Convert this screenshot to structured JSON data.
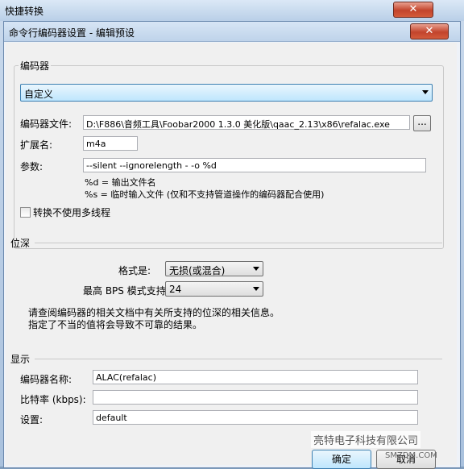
{
  "outer_window": {
    "title": "快捷转换",
    "close_label": "✕",
    "tab_fragment": "……"
  },
  "dialog": {
    "title": "命令行编码器设置 - 编辑预设",
    "close_label": "✕"
  },
  "encoder": {
    "group_label": "编码器",
    "preset_selected": "自定义",
    "file_label": "编码器文件:",
    "file_value": "D:\\F886\\音频工具\\Foobar2000 1.3.0 美化版\\qaac_2.13\\x86\\refalac.exe",
    "browse_label": "...",
    "ext_label": "扩展名:",
    "ext_value": "m4a",
    "params_label": "参数:",
    "params_value": "--silent --ignorelength - -o %d",
    "help_line1": "%d = 输出文件名",
    "help_line2": "%s = 临时输入文件 (仅和不支持管道操作的编码器配合使用)",
    "no_multithread_label": "转换不使用多线程",
    "no_multithread_checked": false
  },
  "bit_depth": {
    "section_label": "位深",
    "format_label": "格式是:",
    "format_value": "无损(或混合)",
    "max_bps_label": "最高 BPS 模式支持:",
    "max_bps_value": "24",
    "info_line1": "请查阅编码器的相关文档中有关所支持的位深的相关信息。",
    "info_line2": "指定了不当的值将会导致不可靠的结果。"
  },
  "display": {
    "section_label": "显示",
    "name_label": "编码器名称:",
    "name_value": "ALAC(refalac)",
    "bitrate_label": "比特率 (kbps):",
    "bitrate_value": "",
    "settings_label": "设置:",
    "settings_value": "default"
  },
  "buttons": {
    "ok": "确定",
    "cancel": "取消"
  },
  "watermark": {
    "text": "亮特电子科技有限公司",
    "sub": "SMZDM.COM"
  }
}
